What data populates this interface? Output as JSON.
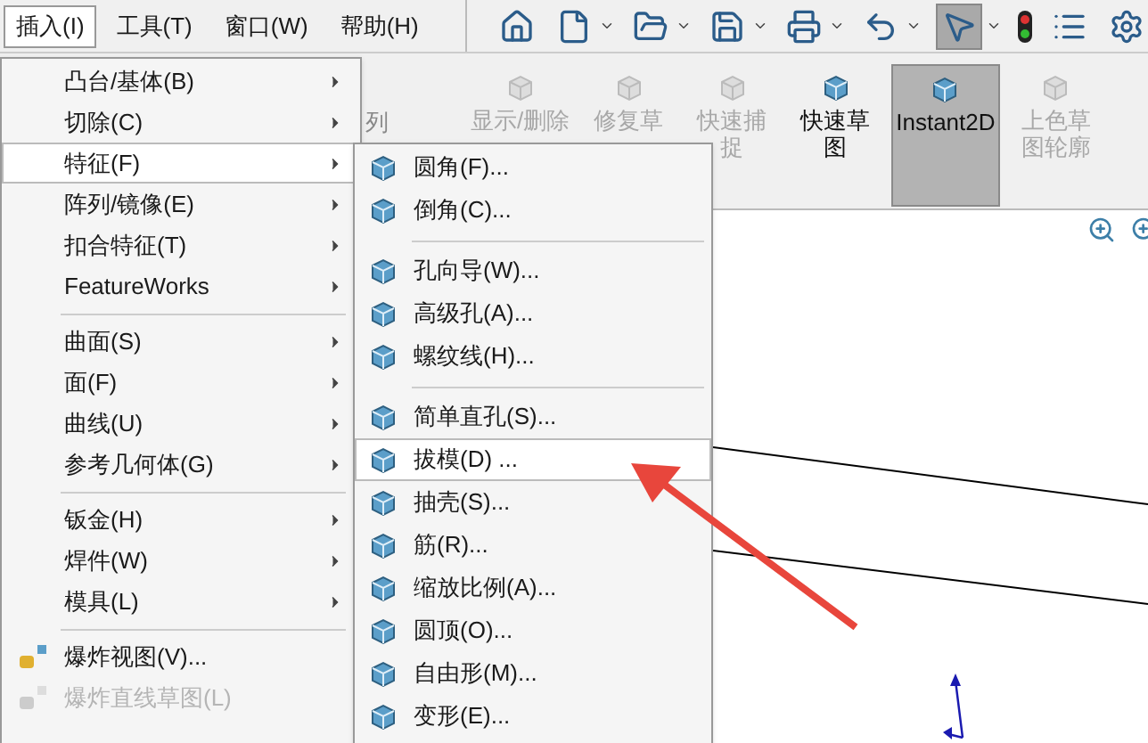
{
  "menubar": {
    "items": [
      {
        "label": "插入(I)",
        "selected": true
      },
      {
        "label": "工具(T)",
        "selected": false
      },
      {
        "label": "窗口(W)",
        "selected": false
      },
      {
        "label": "帮助(H)",
        "selected": false
      }
    ]
  },
  "ribbon": {
    "fragment": "列",
    "buttons": [
      {
        "lines": [
          "显示/删除"
        ],
        "disabled": true,
        "selected": false
      },
      {
        "lines": [
          "修复草"
        ],
        "disabled": true,
        "selected": false
      },
      {
        "lines": [
          "快速捕",
          "捉"
        ],
        "disabled": true,
        "selected": false
      },
      {
        "lines": [
          "快速草",
          "图"
        ],
        "disabled": false,
        "selected": false
      },
      {
        "lines": [
          "Instant2D"
        ],
        "disabled": false,
        "selected": true
      },
      {
        "lines": [
          "上色草",
          "图轮廓"
        ],
        "disabled": true,
        "selected": false
      }
    ]
  },
  "menu": {
    "items": [
      {
        "kind": "item",
        "label": "凸台/基体(B)",
        "submenu": true,
        "selected": false,
        "disabled": false
      },
      {
        "kind": "item",
        "label": "切除(C)",
        "submenu": true,
        "selected": false,
        "disabled": false
      },
      {
        "kind": "item",
        "label": "特征(F)",
        "submenu": true,
        "selected": true,
        "disabled": false
      },
      {
        "kind": "item",
        "label": "阵列/镜像(E)",
        "submenu": true,
        "selected": false,
        "disabled": false
      },
      {
        "kind": "item",
        "label": "扣合特征(T)",
        "submenu": true,
        "selected": false,
        "disabled": false
      },
      {
        "kind": "item",
        "label": "FeatureWorks",
        "submenu": true,
        "selected": false,
        "disabled": false
      },
      {
        "kind": "separator"
      },
      {
        "kind": "item",
        "label": "曲面(S)",
        "submenu": true,
        "selected": false,
        "disabled": false
      },
      {
        "kind": "item",
        "label": "面(F)",
        "submenu": true,
        "selected": false,
        "disabled": false
      },
      {
        "kind": "item",
        "label": "曲线(U)",
        "submenu": true,
        "selected": false,
        "disabled": false
      },
      {
        "kind": "item",
        "label": "参考几何体(G)",
        "submenu": true,
        "selected": false,
        "disabled": false
      },
      {
        "kind": "separator"
      },
      {
        "kind": "item",
        "label": "钣金(H)",
        "submenu": true,
        "selected": false,
        "disabled": false
      },
      {
        "kind": "item",
        "label": "焊件(W)",
        "submenu": true,
        "selected": false,
        "disabled": false
      },
      {
        "kind": "item",
        "label": "模具(L)",
        "submenu": true,
        "selected": false,
        "disabled": false
      },
      {
        "kind": "separator"
      },
      {
        "kind": "iconitem",
        "label": "爆炸视图(V)...",
        "submenu": false,
        "selected": false,
        "disabled": false
      },
      {
        "kind": "iconitem",
        "label": "爆炸直线草图(L)",
        "submenu": false,
        "selected": false,
        "disabled": true
      }
    ]
  },
  "submenu": {
    "items": [
      {
        "kind": "item",
        "label": "圆角(F)...",
        "selected": false
      },
      {
        "kind": "item",
        "label": "倒角(C)...",
        "selected": false
      },
      {
        "kind": "separator"
      },
      {
        "kind": "item",
        "label": "孔向导(W)...",
        "selected": false
      },
      {
        "kind": "item",
        "label": "高级孔(A)...",
        "selected": false
      },
      {
        "kind": "item",
        "label": "螺纹线(H)...",
        "selected": false
      },
      {
        "kind": "separator"
      },
      {
        "kind": "item",
        "label": "简单直孔(S)...",
        "selected": false
      },
      {
        "kind": "item",
        "label": "拔模(D) ...",
        "selected": true
      },
      {
        "kind": "item",
        "label": "抽壳(S)...",
        "selected": false
      },
      {
        "kind": "item",
        "label": "筋(R)...",
        "selected": false
      },
      {
        "kind": "item",
        "label": "缩放比例(A)...",
        "selected": false
      },
      {
        "kind": "item",
        "label": "圆顶(O)...",
        "selected": false
      },
      {
        "kind": "item",
        "label": "自由形(M)...",
        "selected": false
      },
      {
        "kind": "item",
        "label": "变形(E)...",
        "selected": false
      }
    ]
  }
}
